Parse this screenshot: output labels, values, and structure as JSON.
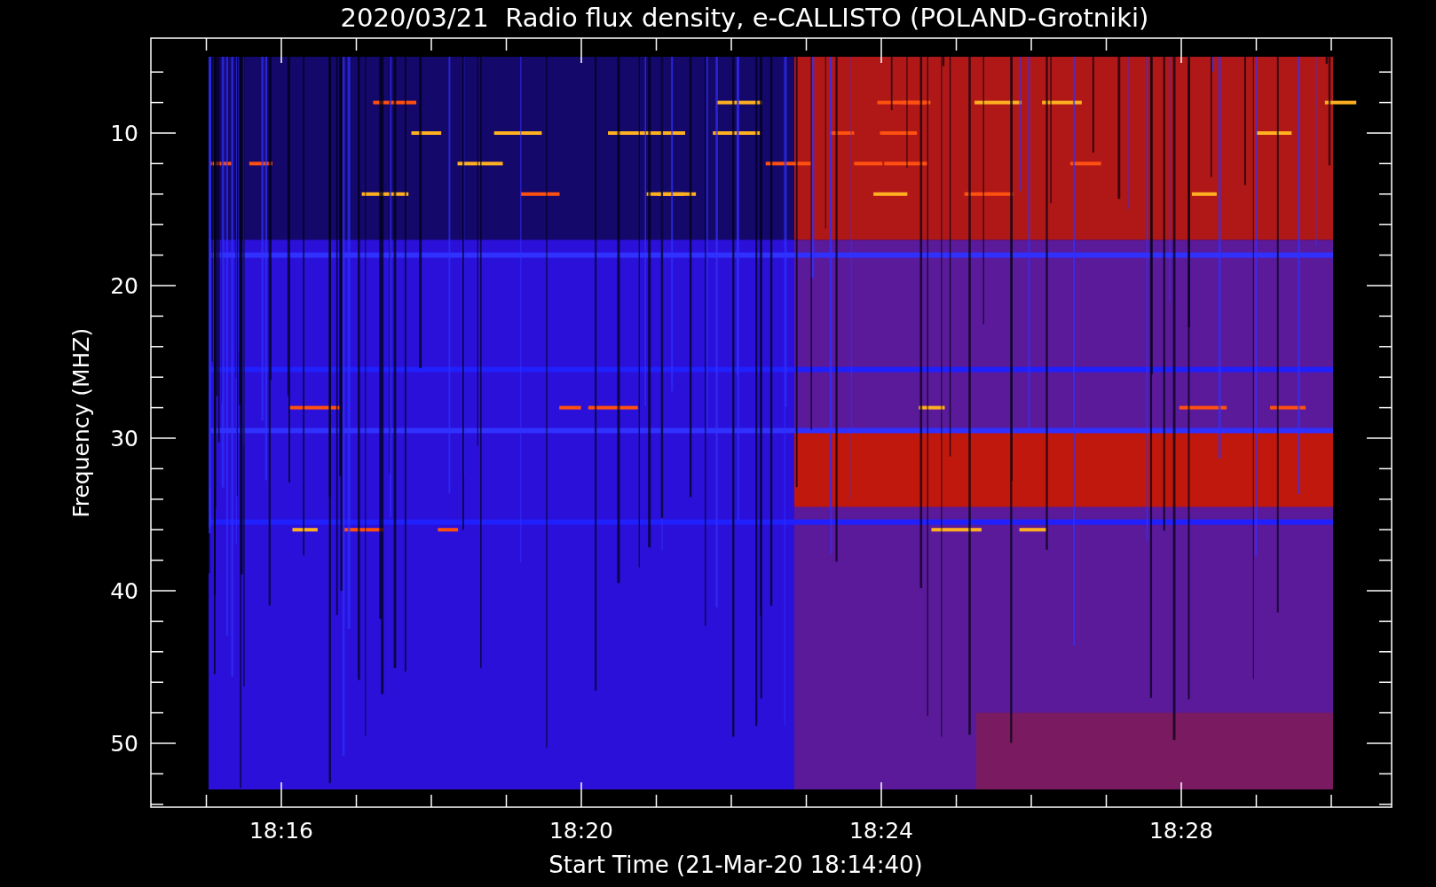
{
  "title": "2020/03/21  Radio flux density, e-CALLISTO (POLAND-Grotniki)",
  "y_axis": {
    "label": "Frequency (MHZ)",
    "ticks": [
      "10",
      "20",
      "30",
      "40",
      "50"
    ]
  },
  "x_axis": {
    "label": "Start Time (21-Mar-20 18:14:40)",
    "ticks": [
      "18:16",
      "18:20",
      "18:24",
      "18:28"
    ]
  }
}
